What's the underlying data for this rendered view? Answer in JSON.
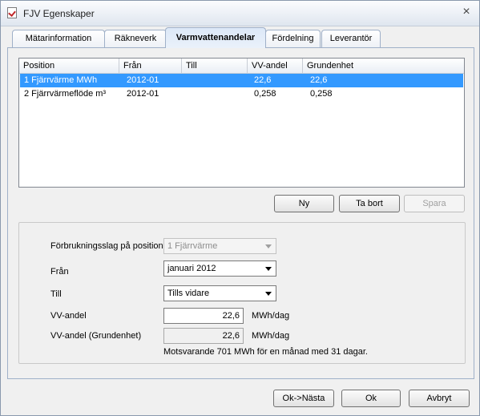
{
  "window": {
    "title": "FJV Egenskaper"
  },
  "tabs": [
    {
      "label": "Mätarinformation"
    },
    {
      "label": "Räkneverk"
    },
    {
      "label": "Varmvattenandelar"
    },
    {
      "label": "Fördelning"
    },
    {
      "label": "Leverantör"
    }
  ],
  "active_tab": "Varmvattenandelar",
  "list": {
    "columns": [
      "Position",
      "Från",
      "Till",
      "VV-andel",
      "Grundenhet"
    ],
    "rows": [
      {
        "position": "1 Fjärrvärme MWh",
        "fran": "2012-01",
        "till": "",
        "vv_andel": "22,6",
        "grundenhet": "22,6",
        "selected": true
      },
      {
        "position": "2 Fjärrvärmeflöde m³",
        "fran": "2012-01",
        "till": "",
        "vv_andel": "0,258",
        "grundenhet": "0,258",
        "selected": false
      }
    ]
  },
  "list_buttons": {
    "new": "Ny",
    "delete": "Ta bort",
    "save": "Spara"
  },
  "form": {
    "forbrukningsslag_label": "Förbrukningsslag på position",
    "forbrukningsslag_value": "1 Fjärrvärme",
    "fran_label": "Från",
    "fran_value": "januari 2012",
    "till_label": "Till",
    "till_value": "Tills vidare",
    "vv_andel_label": "VV-andel",
    "vv_andel_value": "22,6",
    "vv_andel_unit": "MWh/dag",
    "vv_grund_label": "VV-andel (Grundenhet)",
    "vv_grund_value": "22,6",
    "vv_grund_unit": "MWh/dag",
    "motsvarande_text": "Motsvarande  701 MWh för en månad med 31 dagar."
  },
  "footer_buttons": {
    "ok_next": "Ok->Nästa",
    "ok": "Ok",
    "cancel": "Avbryt"
  }
}
